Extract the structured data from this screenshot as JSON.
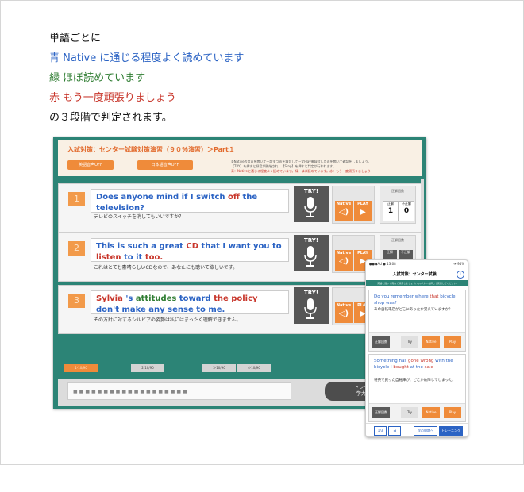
{
  "legend": {
    "intro": "単語ごとに",
    "blue": "青 Native に通じる程度よく読めています",
    "green": "緑 ほぼ読めています",
    "red": "赤 もう一度頑張りましょう",
    "outro": "の３段階で判定されます。"
  },
  "colors": {
    "blue": "#2b63c4",
    "green": "#2f7d32",
    "red": "#c8362b",
    "panel": "#2c8476",
    "accent": "#ef8b3a"
  },
  "desktop": {
    "title": "入試対策：センター試験対策演習（９０％演習）＞Part１",
    "btn_a": "英語音声OFF",
    "btn_b": "日本語音声OFF",
    "note1": "①Nativeの音声を聞いて一語ずつ声を録音して一文Play後録音した声を聞いて確認をしましょう。",
    "note2": "【TRY】を押すと録音が開始され、【Stop】を押すと判定が行われます。",
    "note3": "青：Nativeに通じる程度よく読めています。緑：ほぼ読めています。赤：もう一度頑張りましょう",
    "try_label": "TRY!",
    "native_label": "Native",
    "play_label": "PLAY",
    "score_label": "正解回数",
    "correct_label": "正解",
    "wrong_label": "不正解",
    "questions": [
      {
        "num": "1",
        "parts": [
          {
            "t": "Does anyone mind if I switch ",
            "c": "blue"
          },
          {
            "t": "off",
            "c": "red"
          },
          {
            "t": " the television?",
            "c": "blue"
          }
        ],
        "ja": "テレビのスイッチを消してもいいですか？",
        "correct": "1",
        "wrong": "0"
      },
      {
        "num": "2",
        "parts": [
          {
            "t": "This is such a great ",
            "c": "blue"
          },
          {
            "t": "CD",
            "c": "red"
          },
          {
            "t": " that I want you to ",
            "c": "blue"
          },
          {
            "t": "listen",
            "c": "red"
          },
          {
            "t": " to it ",
            "c": "blue"
          },
          {
            "t": "too.",
            "c": "red"
          }
        ],
        "ja": "これはとても素晴らしいCDなので、あなたにも聴いて欲しいです。"
      },
      {
        "num": "3",
        "parts": [
          {
            "t": "Sylvia",
            "c": "red"
          },
          {
            "t": " 's ",
            "c": "blue"
          },
          {
            "t": "attitudes",
            "c": "green"
          },
          {
            "t": " toward ",
            "c": "blue"
          },
          {
            "t": "the policy",
            "c": "red"
          },
          {
            "t": " don't make any sense to me.",
            "c": "blue"
          }
        ],
        "ja": "その方針に対するシルビアの姿勢は私にはまったく理解できません。"
      }
    ],
    "tabs": [
      "1-10/90",
      "2-10/90",
      "3-10/90",
      "4-10/90"
    ],
    "input_placeholder": "■■■■■■■■■■■■■■■■■■■",
    "train_line1": "トレーニング",
    "train_line2": "学力POINT"
  },
  "phone": {
    "status_left": "●●●AU ● 13:08",
    "status_right": "✈ 94%",
    "title": "入試対策：センター試験...",
    "info": "i",
    "bar": "英語を聞いて真似て録音しましょう(Try)ボタンを押して発音してください",
    "q1_parts": [
      {
        "t": "Do you remember where ",
        "c": "blue"
      },
      {
        "t": "that",
        "c": "red"
      },
      {
        "t": " bicycle shop was?",
        "c": "blue"
      }
    ],
    "q1_ja": "あの自転車店がどこにあったか覚えていますか？",
    "q2_parts": [
      {
        "t": "Something has ",
        "c": "blue"
      },
      {
        "t": "gone wrong",
        "c": "red"
      },
      {
        "t": " with the bicycle I ",
        "c": "blue"
      },
      {
        "t": "bought",
        "c": "red"
      },
      {
        "t": " at the ",
        "c": "blue"
      },
      {
        "t": "sale",
        "c": "red"
      }
    ],
    "q2_ja": "特売で買った自転車が、どこか故障してしまった。",
    "score": "正解回数",
    "try": "Try",
    "native": "Native",
    "play": "Play",
    "nav_prev": "1/3",
    "nav_mid": "◀",
    "nav_next": "次の問題へ",
    "nav_train": "トレーニング"
  }
}
